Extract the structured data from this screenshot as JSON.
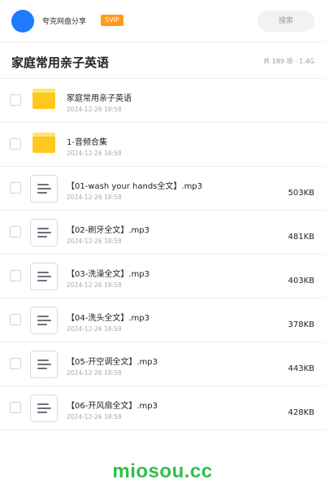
{
  "header": {
    "app_name": "夸克网盘分享",
    "badge": "SVIP",
    "search_label": "搜索"
  },
  "folder": {
    "title": "家庭常用亲子英语",
    "meta": "共 189 项 · 1.4G"
  },
  "items": [
    {
      "type": "folder",
      "name": "家庭常用亲子英语",
      "date": "2024-12-26 18:58",
      "size": ""
    },
    {
      "type": "folder",
      "name": "1-音频合集",
      "date": "2024-12-26 18:58",
      "size": ""
    },
    {
      "type": "file",
      "name": "【01-wash your hands全文】.mp3",
      "date": "2024-12-26 18:58",
      "size": "503KB"
    },
    {
      "type": "file",
      "name": "【02-刷牙全文】.mp3",
      "date": "2024-12-26 18:58",
      "size": "481KB"
    },
    {
      "type": "file",
      "name": "【03-洗澡全文】.mp3",
      "date": "2024-12-26 18:58",
      "size": "403KB"
    },
    {
      "type": "file",
      "name": "【04-洗头全文】.mp3",
      "date": "2024-12-26 18:58",
      "size": "378KB"
    },
    {
      "type": "file",
      "name": "【05-开空调全文】.mp3",
      "date": "2024-12-26 18:58",
      "size": "443KB"
    },
    {
      "type": "file",
      "name": "【06-开风扇全文】.mp3",
      "date": "2024-12-26 18:58",
      "size": "428KB"
    }
  ],
  "watermark": "miosou.cc",
  "colors": {
    "avatar": "#1e7bff",
    "badge": "#ff9a1f",
    "folder": "#ffc81e",
    "watermark": "#2fbf4a"
  },
  "icons": {
    "folder": "folder-icon",
    "file": "document-icon"
  }
}
